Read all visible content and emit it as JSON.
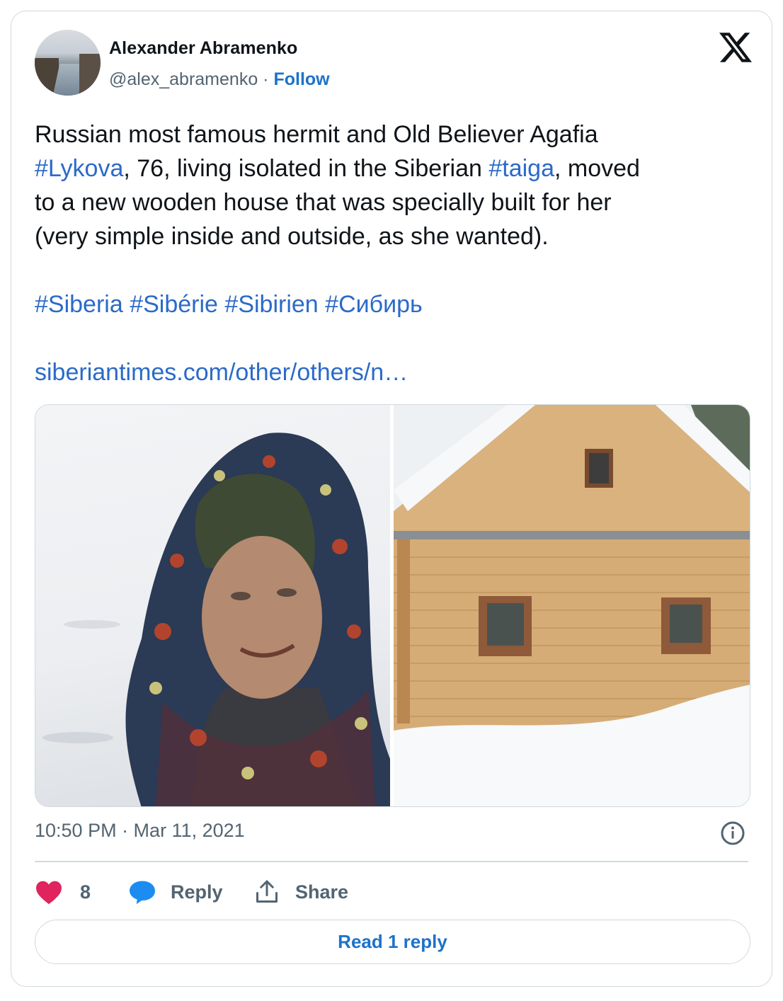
{
  "author": {
    "name": "Alexander Abramenko",
    "handle": "@alex_abramenko",
    "separator": "·",
    "follow_label": "Follow"
  },
  "tweet": {
    "segments": [
      {
        "text": "Russian most famous hermit and Old Believer Agafia\n",
        "type": "plain"
      },
      {
        "text": "#Lykova",
        "type": "tag"
      },
      {
        "text": ", 76, living isolated in the Siberian ",
        "type": "plain"
      },
      {
        "text": "#taiga",
        "type": "tag"
      },
      {
        "text": ", moved\nto a new wooden house that was specially built for her\n(very simple inside and outside, as she wanted).\n\n",
        "type": "plain"
      },
      {
        "text": "#Siberia",
        "type": "tag"
      },
      {
        "text": " ",
        "type": "plain"
      },
      {
        "text": "#Sibérie",
        "type": "tag"
      },
      {
        "text": " ",
        "type": "plain"
      },
      {
        "text": "#Sibirien",
        "type": "tag"
      },
      {
        "text": " ",
        "type": "plain"
      },
      {
        "text": "#Сибирь",
        "type": "tag"
      },
      {
        "text": "\n\n",
        "type": "plain"
      },
      {
        "text": "siberiantimes.com/other/others/n…",
        "type": "tag"
      }
    ]
  },
  "meta": {
    "timestamp": "10:50 PM · Mar 11, 2021"
  },
  "actions": {
    "like_count": "8",
    "reply_label": "Reply",
    "share_label": "Share"
  },
  "read_replies_label": "Read 1 reply",
  "icons": {
    "brand": "x-logo-icon",
    "like": "heart-icon",
    "reply": "speech-bubble-icon",
    "share": "share-arrow-icon",
    "info": "info-icon"
  },
  "colors": {
    "link": "#2b6ac8",
    "like": "#e0245e",
    "reply_bubble": "#1d8cf0",
    "muted": "#536471",
    "border": "#cfd9de"
  }
}
